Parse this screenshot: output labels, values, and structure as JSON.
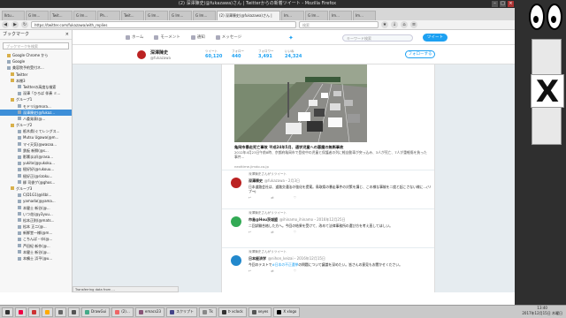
{
  "window": {
    "title": "(2) 深澤陳史(@fukazawa)さん | Twitterからの新着ツイート - Mozilla Firefox"
  },
  "tabs": [
    "Iktu...",
    "G Im...",
    "Twit...",
    "G Im...",
    "Ph...",
    "Twit...",
    "G Im...",
    "G Im...",
    "G Im...",
    "(2) 深澤陳史(@fukazawa)さん |",
    "Im...",
    "G Im...",
    "Im...",
    "Im..."
  ],
  "navbar": {
    "url": "https://twitter.com/fukazawa/with_replies",
    "search_placeholder": "検索"
  },
  "sidebar": {
    "title": "ブックマーク",
    "close": "×",
    "search_placeholder": "ブックマークを検索",
    "items": [
      {
        "label": "Google Chrome から",
        "icon": "folder",
        "selected": false
      },
      {
        "label": "Google",
        "icon": "page",
        "selected": false
      },
      {
        "label": "美容院予約受付ネ...",
        "icon": "page",
        "selected": false
      },
      {
        "label": "Twitter",
        "icon": "folder",
        "selected": false
      },
      {
        "label": "本棚3",
        "icon": "folder",
        "selected": false
      },
      {
        "label": "Twitterの高度な検索",
        "icon": "page",
        "selected": false
      },
      {
        "label": "深澤「ひろば 伴奏 ミ...",
        "icon": "page",
        "selected": false
      },
      {
        "label": "グループ1",
        "icon": "folder",
        "selected": false
      },
      {
        "label": "モドリ(@mora...",
        "icon": "page",
        "selected": false
      },
      {
        "label": "深澤陳史(@fukaz...",
        "icon": "page",
        "selected": true
      },
      {
        "label": "ハ委発表(@...",
        "icon": "page",
        "selected": false
      },
      {
        "label": "グループ2",
        "icon": "folder",
        "selected": false
      },
      {
        "label": "栃木県(ぐてレングス...",
        "icon": "page",
        "selected": false
      },
      {
        "label": "Mutsu Ugawa(@m...",
        "icon": "page",
        "selected": false
      },
      {
        "label": "マイ天気(@wasaa...",
        "icon": "page",
        "selected": false
      },
      {
        "label": "鉄板 新鮮(@s...",
        "icon": "page",
        "selected": false
      },
      {
        "label": "影響まぽ(@rasa...",
        "icon": "page",
        "selected": false
      },
      {
        "label": "yukito(@yukoku...",
        "icon": "page",
        "selected": false
      },
      {
        "label": "極好好(@rukouu...",
        "icon": "page",
        "selected": false
      },
      {
        "label": "極好正(@rizoku...",
        "icon": "page",
        "selected": false
      },
      {
        "label": "柳 司俊ゲ(@ghos...",
        "icon": "page",
        "selected": false
      },
      {
        "label": "グループ3",
        "icon": "folder",
        "selected": false
      },
      {
        "label": "C(D1G1(@l4bl...",
        "icon": "page",
        "selected": false
      },
      {
        "label": "yamada(@yama...",
        "icon": "page",
        "selected": false
      },
      {
        "label": "本健士 新谷(@...",
        "icon": "page",
        "selected": false
      },
      {
        "label": "いつ花(@y3yuu...",
        "icon": "page",
        "selected": false
      },
      {
        "label": "松本正則(@mats...",
        "icon": "page",
        "selected": false
      },
      {
        "label": "松本 正二(@...",
        "icon": "page",
        "selected": false
      },
      {
        "label": "新鮮堂一様(@m...",
        "icon": "page",
        "selected": false
      },
      {
        "label": "こちんぱ・ゆ(@...",
        "icon": "page",
        "selected": false
      },
      {
        "label": "芦田紀 新作(@...",
        "icon": "page",
        "selected": false
      },
      {
        "label": "本健士 新谷(@...",
        "icon": "page",
        "selected": false
      },
      {
        "label": "本鶴士 浜平(@u...",
        "icon": "page",
        "selected": false
      }
    ]
  },
  "twitter": {
    "nav": [
      {
        "label": "ホーム",
        "icon": "home-icon"
      },
      {
        "label": "モーメント",
        "icon": "lightning-icon"
      },
      {
        "label": "通知",
        "icon": "bell-icon"
      },
      {
        "label": "メッセージ",
        "icon": "envelope-icon"
      }
    ],
    "search_placeholder": "キーワード検索",
    "tweet_button": "ツイート",
    "profile": {
      "name": "深澤陳史",
      "handle": "@fukazawa"
    },
    "stats": [
      {
        "label": "ツイート",
        "value": "60,120"
      },
      {
        "label": "フォロー",
        "value": "440"
      },
      {
        "label": "フォロワー",
        "value": "3,491"
      },
      {
        "label": "いいね",
        "value": "24,324"
      }
    ],
    "follow_button": "フォローする",
    "card": {
      "title": "亀岡市暴走死亡事故 平成24年5月、通学児童への悪魔の無断事故",
      "desc": "2012年4月23日午前8時、京都府亀岡市で登校中の児童と保護者の列に軽自動車が突っ込み、3人が死亡、7人が重軽傷を負った事件…",
      "src": "nexttime.jimdo.co.jp"
    },
    "tweets": [
      {
        "retweeted_by": "深澤陳史さんがリツイート",
        "name": "深澤陳史",
        "handle": "@fukazawa・2月3日",
        "text": "日本道路会社は、道路交通法の強化を提案。鳥取県の暴走事件の対策を講じ、この様な事故を二度と起こさない様に…",
        "link": "",
        "after": "(リプ→)",
        "actions": [
          "↩",
          "⇄",
          "♡"
        ]
      },
      {
        "retweeted_by": "深澤陳史さんがリツイート",
        "name": "市島@Hou茨城盟",
        "handle": "@ihinamo_ihinamo・2016年12月25日",
        "text": "二回試験合格した方へ。今回の結果を受けて、改めて法律事務所の選び方を考え直してほしい。",
        "link": "",
        "after": "",
        "actions": [
          "↩",
          "⇄",
          "♡"
        ]
      },
      {
        "retweeted_by": "深澤陳史さんがリツイート",
        "name": "日本経済学",
        "handle": "@nihon_keizai・2016年12月15日",
        "text": "今回のテストで",
        "link": "#日本の不正選挙",
        "after": "の問題について議論を深めたい。皆さんの意見もお聞かせください。",
        "actions": [
          "↩",
          "⇄",
          "♡"
        ]
      }
    ]
  },
  "statusbar": "Transferring data from ...",
  "taskbar": [
    {
      "label": "",
      "color": "#333"
    },
    {
      "label": "",
      "color": "#e04"
    },
    {
      "label": "",
      "color": "#c33"
    },
    {
      "label": "",
      "color": "#fa0"
    },
    {
      "label": "",
      "color": "#666"
    },
    {
      "label": "",
      "color": "#555"
    },
    {
      "label": "DrawGui",
      "color": "#4a8"
    },
    {
      "label": "(2)…",
      "color": "#e66"
    },
    {
      "label": "emacs23",
      "color": "#857"
    },
    {
      "label": "スクリプト",
      "color": "#448"
    },
    {
      "label": "Tk",
      "color": "#888"
    },
    {
      "label": "ᐅ xclock",
      "color": "#333"
    },
    {
      "label": "xeyes",
      "color": "#555"
    },
    {
      "label": "X xlogo",
      "color": "#000"
    }
  ],
  "clock": {
    "time": "13:40",
    "date": "2017年12月15日 木曜日"
  }
}
